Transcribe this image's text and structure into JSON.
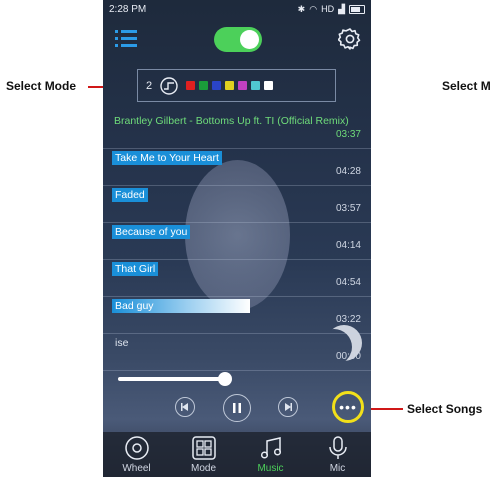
{
  "status": {
    "time": "2:28 PM",
    "network": "HD"
  },
  "mode": {
    "number": "2",
    "swatches": [
      "#e02020",
      "#1a9d3a",
      "#2a44c8",
      "#e0d020",
      "#c040c0",
      "#50c8d0",
      "#ffffff"
    ]
  },
  "songs": [
    {
      "title": "Brantley Gilbert - Bottoms Up ft. TI (Official Remix)",
      "duration": "03:37",
      "state": "playing"
    },
    {
      "title": "Take Me to Your Heart",
      "duration": "04:28",
      "state": "normal"
    },
    {
      "title": "Faded",
      "duration": "03:57",
      "state": "normal"
    },
    {
      "title": "Because of you",
      "duration": "04:14",
      "state": "normal"
    },
    {
      "title": "That Girl",
      "duration": "04:54",
      "state": "normal"
    },
    {
      "title": "Bad guy",
      "duration": "03:22",
      "state": "gradient"
    },
    {
      "title": "ise",
      "duration": "00:00",
      "state": "plain"
    }
  ],
  "playback": {
    "progress": 0.45
  },
  "tabs": [
    {
      "label": "Wheel",
      "icon": "wheel-icon"
    },
    {
      "label": "Mode",
      "icon": "mode-icon"
    },
    {
      "label": "Music",
      "icon": "music-icon"
    },
    {
      "label": "Mic",
      "icon": "mic-icon"
    }
  ],
  "annotations": {
    "select_mode": "Select Mode",
    "select_mode_right": "Select M",
    "select_songs": "Select Songs"
  },
  "colors": {
    "accent_green": "#4cd05a",
    "highlight_blue": "#1a8fd8",
    "callout_yellow": "#f2e01a",
    "arrow_red": "#d01818"
  }
}
